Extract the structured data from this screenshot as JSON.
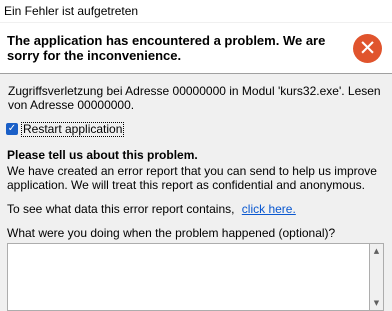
{
  "window": {
    "title": "Ein Fehler ist aufgetreten"
  },
  "banner": {
    "message": "The application has encountered a problem. We are sorry for the inconvenience.",
    "icon": "error-close-icon",
    "icon_color": "#e0542d"
  },
  "detail": {
    "text": "Zugriffsverletzung bei Adresse 00000000 in Modul 'kurs32.exe'. Lesen von Adresse 00000000."
  },
  "restart": {
    "label": "Restart application",
    "checked": true
  },
  "report": {
    "heading": "Please tell us about this problem.",
    "body": "We have created an error report that you can send to help us improve application. We will treat this report as confidential and anonymous.",
    "see_text": "To see what data this error report contains,",
    "link_text": "click here."
  },
  "question": {
    "label": "What were you doing when the problem happened (optional)?",
    "value": ""
  }
}
